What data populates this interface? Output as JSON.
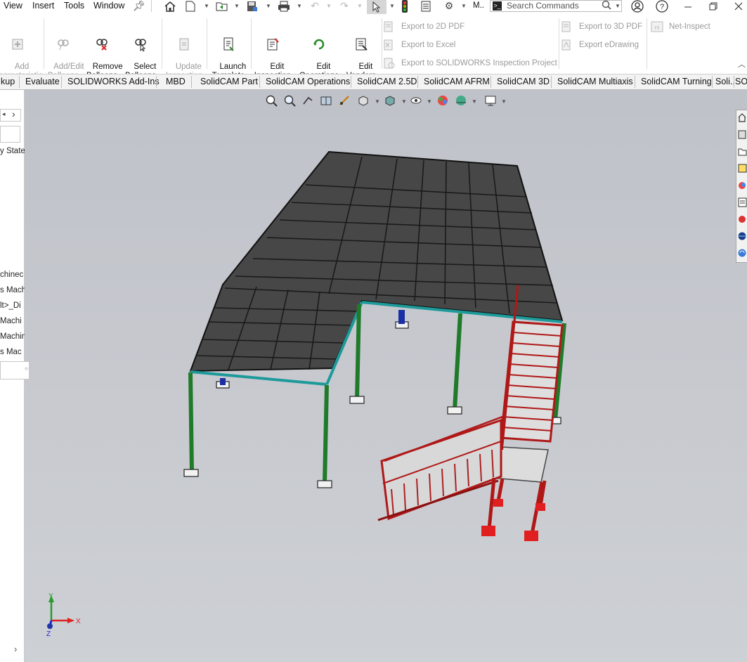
{
  "menu": {
    "view": "View",
    "insert": "Insert",
    "tools": "Tools",
    "window": "Window",
    "model_abbrev": "M.."
  },
  "search": {
    "placeholder": "Search Commands",
    "prompt_icon": "command-prompt-icon"
  },
  "ribbon": {
    "add_characteristic": "Add\nCharacteristic",
    "add_edit_balloons": "Add/Edit\nBalloons",
    "remove_balloons": "Remove\nBalloons",
    "select_balloons": "Select\nBalloons",
    "update_inspection_project": "Update\nInspection\nProject",
    "launch_template_editor": "Launch\nTemplate\nEditor",
    "edit_inspection_methods": "Edit\nInspection\nMethods",
    "edit_operations": "Edit\nOperations",
    "edit_vendors": "Edit\nVendors",
    "export_2d_pdf": "Export to 2D PDF",
    "export_excel": "Export to Excel",
    "export_sw_inspection": "Export to SOLIDWORKS Inspection Project",
    "export_3d_pdf": "Export to 3D PDF",
    "export_edrawing": "Export eDrawing",
    "net_inspect": "Net-Inspect"
  },
  "tabs": [
    "kup",
    "Evaluate",
    "SOLIDWORKS Add-Ins",
    "MBD",
    "SolidCAM Part",
    "SolidCAM Operations",
    "SolidCAM 2.5D",
    "SolidCAM AFRM",
    "SolidCAM 3D",
    "SolidCAM Multiaxis",
    "SolidCAM Turning",
    "Soli...",
    "SO"
  ],
  "left_panel": {
    "state": "y State",
    "items": [
      "chinec",
      "s Mach",
      "lt>_Di",
      "Machi",
      "Machin",
      "s Mac"
    ]
  },
  "triad": {
    "x": "X",
    "y": "Y",
    "z": "Z"
  },
  "colors": {
    "accent": "#1a6fc4",
    "columns": "#1f7a2a",
    "beams": "#1e9a9a",
    "deck": "#474747",
    "stairs": "#b01818",
    "base_plates": "#e02020"
  }
}
